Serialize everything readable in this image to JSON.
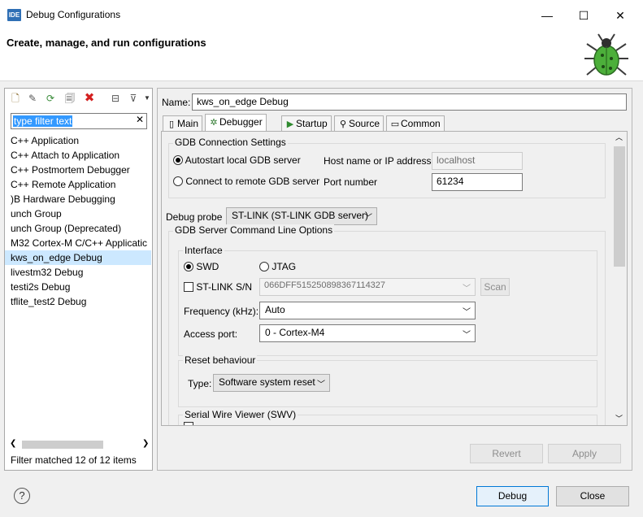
{
  "window": {
    "title": "Debug Configurations",
    "icon_text": "IDE",
    "controls": {
      "minimize": "—",
      "maximize": "☐",
      "close": "✕"
    }
  },
  "header": {
    "title": "Create, manage, and run configurations"
  },
  "left": {
    "toolbar": [
      "new-config-icon",
      "duplicate-icon",
      "export-icon",
      "copy-icon",
      "delete-icon",
      "collapse-all-icon",
      "filter-icon",
      "view-menu-icon"
    ],
    "filter_placeholder": "type filter text",
    "items": [
      {
        "label": "C++ Application"
      },
      {
        "label": "C++ Attach to Application"
      },
      {
        "label": "C++ Postmortem Debugger"
      },
      {
        "label": "C++ Remote Application"
      },
      {
        "label": ")B Hardware Debugging"
      },
      {
        "label": "unch Group"
      },
      {
        "label": "unch Group (Deprecated)"
      },
      {
        "label": "M32 Cortex-M C/C++ Applicatic"
      },
      {
        "label": "kws_on_edge Debug",
        "selected": true
      },
      {
        "label": "livestm32 Debug"
      },
      {
        "label": "testi2s Debug"
      },
      {
        "label": "tflite_test2 Debug"
      }
    ],
    "status": "Filter matched 12 of 12 items"
  },
  "right": {
    "name_label": "Name:",
    "name_value": "kws_on_edge Debug",
    "tabs": [
      {
        "label": "Main",
        "icon": "▯"
      },
      {
        "label": "Debugger",
        "icon": "✲",
        "active": true
      },
      {
        "label": "Startup",
        "icon": "▶"
      },
      {
        "label": "Source",
        "icon": "⚲"
      },
      {
        "label": "Common",
        "icon": "▭"
      }
    ],
    "gdb_conn": {
      "title": "GDB Connection Settings",
      "autostart_label": "Autostart local GDB server",
      "remote_label": "Connect to remote GDB server",
      "host_label": "Host name or IP address",
      "host_value": "localhost",
      "port_label": "Port number",
      "port_value": "61234"
    },
    "probe": {
      "label": "Debug probe",
      "value": "ST-LINK (ST-LINK GDB server)"
    },
    "server_opts": {
      "title": "GDB Server Command Line Options",
      "interface_title": "Interface",
      "swd_label": "SWD",
      "jtag_label": "JTAG",
      "stlink_sn_label": "ST-LINK S/N",
      "stlink_sn_value": "066DFF515250898367114327",
      "scan_label": "Scan",
      "freq_label": "Frequency (kHz):",
      "freq_value": "Auto",
      "access_label": "Access port:",
      "access_value": "0 - Cortex-M4",
      "reset_title": "Reset behaviour",
      "type_label": "Type:",
      "type_value": "Software system reset",
      "swv_title": "Serial Wire Viewer (SWV)"
    },
    "revert_label": "Revert",
    "apply_label": "Apply"
  },
  "footer": {
    "help_symbol": "?",
    "debug_label": "Debug",
    "close_label": "Close"
  }
}
